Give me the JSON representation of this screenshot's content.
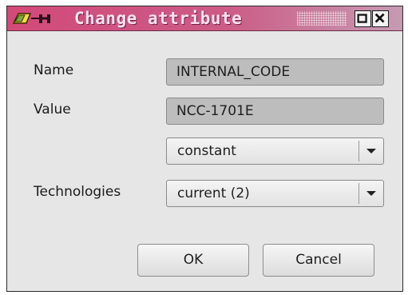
{
  "window": {
    "title": "Change attribute",
    "icons": [
      "pencil-icon",
      "link-icon",
      "maximize-icon",
      "close-icon"
    ]
  },
  "form": {
    "name_label": "Name",
    "name_value": "INTERNAL_CODE",
    "value_label": "Value",
    "value_value": "NCC-1701E",
    "type_selected": "constant",
    "technologies_label": "Technologies",
    "technologies_selected": "current (2)"
  },
  "buttons": {
    "ok_label": "OK",
    "cancel_label": "Cancel"
  },
  "colors": {
    "titlebar": "#d24a78",
    "dialog_bg": "#e6e6e6",
    "readonly_field": "#bdbdbd"
  }
}
